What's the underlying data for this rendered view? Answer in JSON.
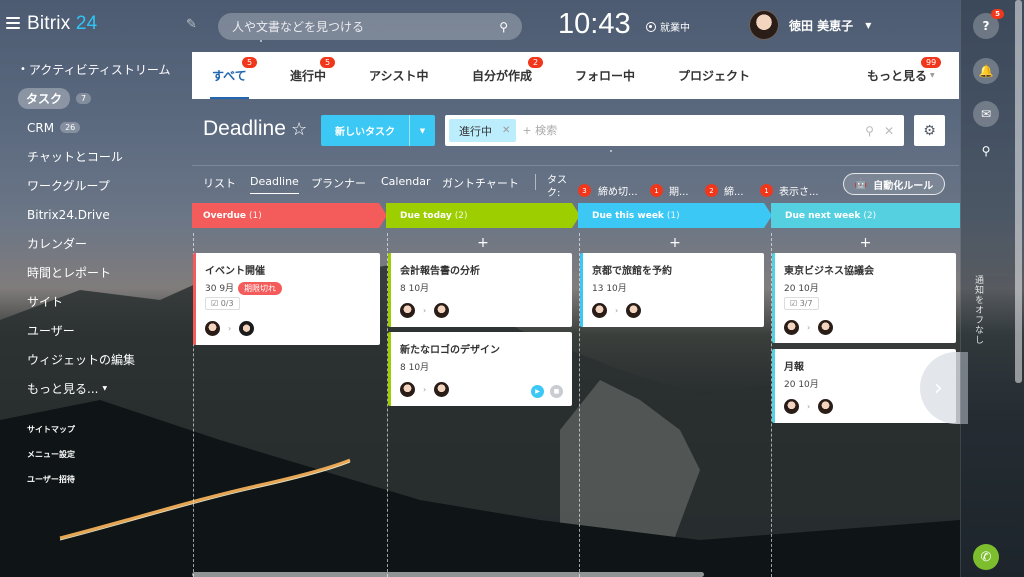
{
  "app": {
    "logo_main": "Bitrix",
    "logo_accent": "24"
  },
  "header": {
    "search_placeholder": "人や文書などを見つける",
    "clock": "10:43",
    "workday_status": "就業中",
    "user_name": "徳田 美恵子"
  },
  "sidebar": {
    "items": [
      {
        "label": "アクティビティストリーム"
      },
      {
        "label": "タスク",
        "count": "7"
      },
      {
        "label": "CRM",
        "count": "26"
      },
      {
        "label": "チャットとコール"
      },
      {
        "label": "ワークグループ"
      },
      {
        "label": "Bitrix24.Drive"
      },
      {
        "label": "カレンダー"
      },
      {
        "label": "時間とレポート"
      },
      {
        "label": "サイト"
      },
      {
        "label": "ユーザー"
      },
      {
        "label": "ウィジェットの編集"
      },
      {
        "label": "もっと見る..."
      }
    ],
    "small_items": [
      {
        "label": "サイトマップ"
      },
      {
        "label": "メニュー設定"
      },
      {
        "label": "ユーザー招待"
      }
    ]
  },
  "tabs": [
    {
      "label": "すべて",
      "badge": "5"
    },
    {
      "label": "進行中",
      "badge": "5"
    },
    {
      "label": "アシスト中",
      "badge": ""
    },
    {
      "label": "自分が作成",
      "badge": "2"
    },
    {
      "label": "フォロー中",
      "badge": ""
    },
    {
      "label": "プロジェクト",
      "badge": ""
    },
    {
      "label": "もっと見る",
      "badge": "99"
    }
  ],
  "title_row": {
    "title": "Deadline",
    "new_task_label": "新しいタスク",
    "filter_chip": "進行中",
    "filter_placeholder": "+ 検索"
  },
  "views": {
    "links": [
      "リスト",
      "Deadline",
      "プランナー",
      "Calendar",
      "ガントチャート"
    ],
    "counter_title": "タスク:",
    "counters": [
      {
        "count": "3",
        "label": "締め切..."
      },
      {
        "count": "1",
        "label": "期..."
      },
      {
        "count": "2",
        "label": "締..."
      },
      {
        "count": "1",
        "label": "表示さ..."
      }
    ],
    "automation_label": "自動化ルール"
  },
  "columns": [
    {
      "title": "Overdue",
      "count": "(1)",
      "color": "#f45b5b"
    },
    {
      "title": "Due today",
      "count": "(2)",
      "color": "#9dcf00"
    },
    {
      "title": "Due this week",
      "count": "(1)",
      "color": "#3bc8f5"
    },
    {
      "title": "Due next week",
      "count": "(2)",
      "color": "#55d0e0"
    }
  ],
  "cards": {
    "c1": {
      "title": "イベント開催",
      "date": "30 9月",
      "badge": "期限切れ",
      "checklist": "0/3"
    },
    "c2": {
      "title": "会計報告書の分析",
      "date": "8 10月"
    },
    "c3": {
      "title": "新たなロゴのデザイン",
      "date": "8 10月"
    },
    "c4": {
      "title": "京都で旅館を予約",
      "date": "13 10月"
    },
    "c5": {
      "title": "東京ビジネス協議会",
      "date": "20 10月",
      "checklist": "3/7"
    },
    "c6": {
      "title": "月報",
      "date": "20 10月"
    }
  },
  "rail": {
    "help_badge": "5",
    "vertical_text": "通知をオフなし"
  },
  "colors": {
    "accent": "#2066b0",
    "button": "#3bc8f5",
    "badge": "#f0371b"
  }
}
